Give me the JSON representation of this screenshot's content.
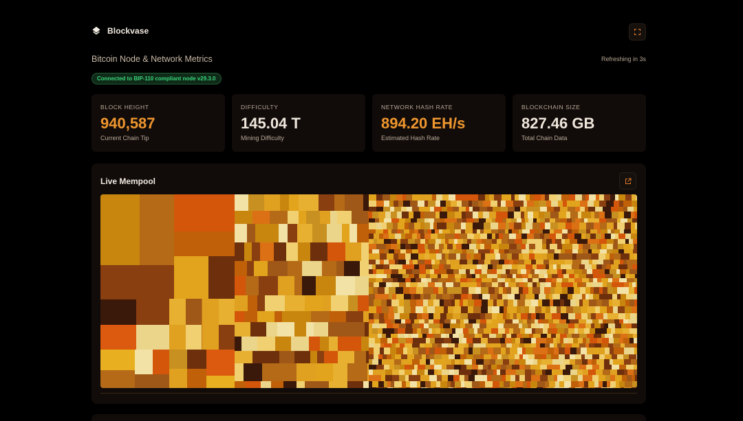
{
  "app": {
    "name": "Blockvase"
  },
  "header": {
    "subtitle": "Bitcoin Node & Network Metrics",
    "refresh_status": "Refreshing in 3s",
    "connection_badge": "Connected to BIP-110 compliant node v29.3.0"
  },
  "metrics": [
    {
      "label": "BLOCK HEIGHT",
      "value": "940,587",
      "sub": "Current Chain Tip",
      "color": "#f0962e"
    },
    {
      "label": "DIFFICULTY",
      "value": "145.04 T",
      "sub": "Mining Difficulty",
      "color": "#efe6dc"
    },
    {
      "label": "NETWORK HASH RATE",
      "value": "894.20 EH/s",
      "sub": "Estimated Hash Rate",
      "color": "#f0962e"
    },
    {
      "label": "BLOCKCHAIN SIZE",
      "value": "827.46 GB",
      "sub": "Total Chain Data",
      "color": "#efe6dc"
    }
  ],
  "mempool": {
    "title": "Live Mempool",
    "palette": [
      "#c8860f",
      "#b46a16",
      "#d4560a",
      "#c06008",
      "#e2a41c",
      "#8a3f10",
      "#6e2f0c",
      "#3a180a",
      "#e0a020",
      "#ead58a",
      "#f0d070",
      "#e8b030",
      "#c89020",
      "#a05818",
      "#f3e2a6",
      "#dc7014"
    ]
  },
  "icons": {
    "logo": "diamond-stack-icon",
    "fullscreen": "fullscreen-icon",
    "external": "external-link-icon"
  }
}
